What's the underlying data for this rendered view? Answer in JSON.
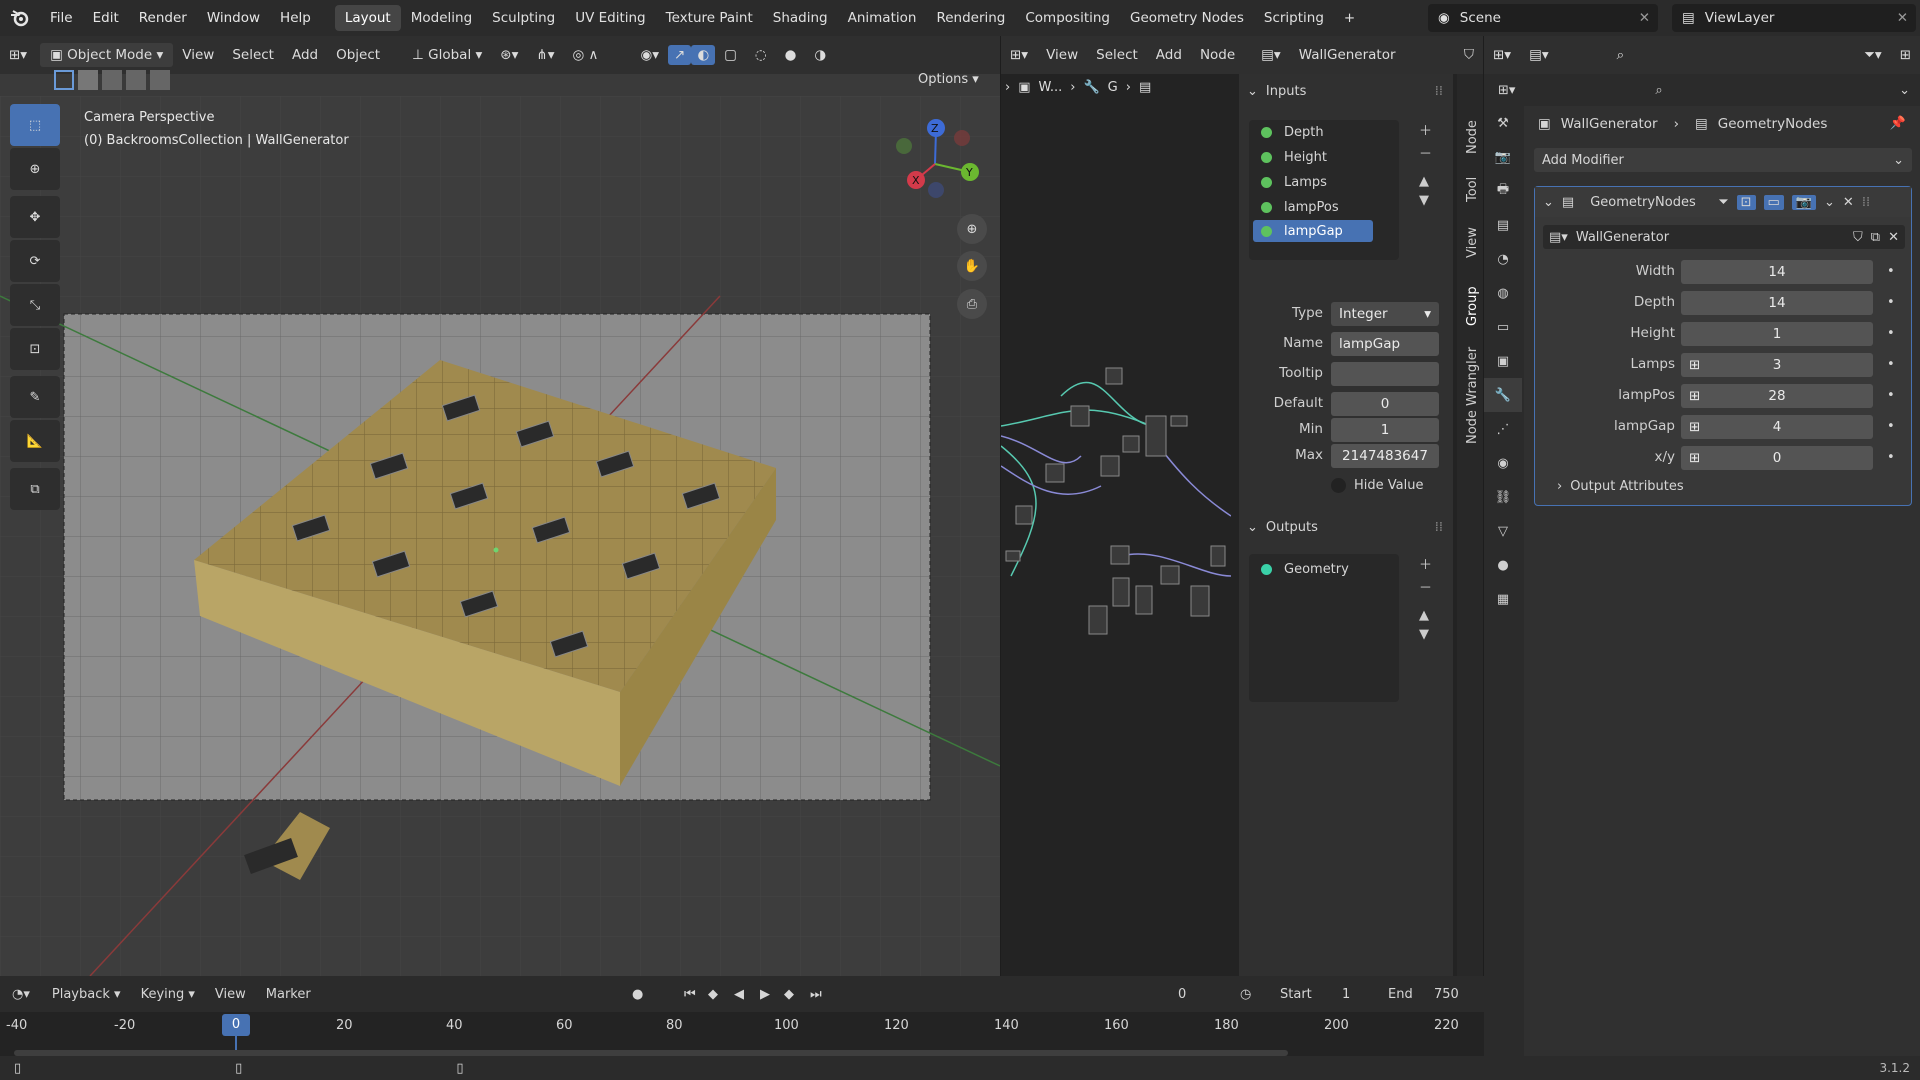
{
  "menu": [
    "File",
    "Edit",
    "Render",
    "Window",
    "Help"
  ],
  "workspaces": [
    "Layout",
    "Modeling",
    "Sculpting",
    "UV Editing",
    "Texture Paint",
    "Shading",
    "Animation",
    "Rendering",
    "Compositing",
    "Geometry Nodes",
    "Scripting"
  ],
  "active_workspace": "Layout",
  "scene": {
    "name": "Scene",
    "viewlayer": "ViewLayer"
  },
  "viewport": {
    "mode": "Object Mode",
    "menus": [
      "View",
      "Select",
      "Add",
      "Object"
    ],
    "orientation": "Global",
    "options": "Options",
    "overlay_title": "Camera Perspective",
    "overlay_sub": "(0) BackroomsCollection | WallGenerator",
    "axes": {
      "x": "X",
      "y": "Y",
      "z": "Z"
    }
  },
  "node_editor": {
    "menus": [
      "View",
      "Select",
      "Add",
      "Node"
    ],
    "tree": "WallGenerator",
    "breadcrumb": [
      "W...",
      "G"
    ],
    "tabs": [
      "Node",
      "Tool",
      "View",
      "Group",
      "Node Wrangler"
    ],
    "inputs_title": "Inputs",
    "inputs": [
      "Depth",
      "Height",
      "Lamps",
      "lampPos",
      "lampGap"
    ],
    "selected_input": "lampGap",
    "props": {
      "type_label": "Type",
      "type_value": "Integer",
      "name_label": "Name",
      "name_value": "lampGap",
      "tooltip_label": "Tooltip",
      "tooltip_value": "",
      "default_label": "Default",
      "default_value": "0",
      "min_label": "Min",
      "min_value": "1",
      "max_label": "Max",
      "max_value": "2147483647",
      "hide_value": "Hide Value"
    },
    "outputs_title": "Outputs",
    "outputs": [
      "Geometry"
    ]
  },
  "properties": {
    "breadcrumb_obj": "WallGenerator",
    "breadcrumb_mod": "GeometryNodes",
    "add_modifier": "Add Modifier",
    "modifier_name": "GeometryNodes",
    "node_group": "WallGenerator",
    "params": [
      {
        "label": "Width",
        "value": "14",
        "icon": false
      },
      {
        "label": "Depth",
        "value": "14",
        "icon": false
      },
      {
        "label": "Height",
        "value": "1",
        "icon": false
      },
      {
        "label": "Lamps",
        "value": "3",
        "icon": true
      },
      {
        "label": "lampPos",
        "value": "28",
        "icon": true
      },
      {
        "label": "lampGap",
        "value": "4",
        "icon": true
      },
      {
        "label": "x/y",
        "value": "0",
        "icon": true
      }
    ],
    "output_attributes": "Output Attributes"
  },
  "timeline": {
    "menus": [
      "Playback",
      "Keying",
      "View",
      "Marker"
    ],
    "current_frame": "0",
    "start_label": "Start",
    "start": "1",
    "end_label": "End",
    "end": "750",
    "ticks": [
      "-40",
      "-20",
      "0",
      "20",
      "40",
      "60",
      "80",
      "100",
      "120",
      "140",
      "160",
      "180",
      "200",
      "220"
    ],
    "playhead": "0"
  },
  "status": {
    "version": "3.1.2"
  },
  "colors": {
    "accent": "#4772b3",
    "socket_green": "#5ec25e",
    "header": "#2b2b2b"
  }
}
